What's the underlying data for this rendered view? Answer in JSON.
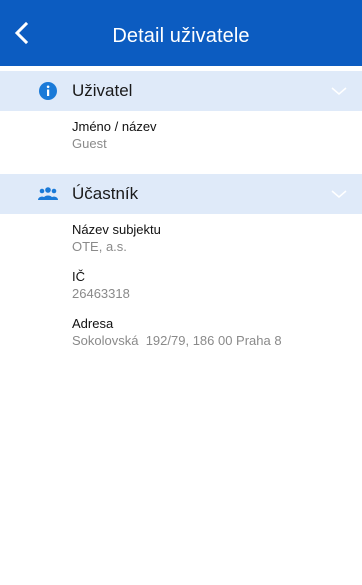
{
  "app_bar": {
    "title": "Detail uživatele",
    "back_icon": "chevron-left-icon"
  },
  "sections": [
    {
      "title": "Uživatel",
      "icon": "info-icon",
      "fields": [
        {
          "label": "Jméno / název",
          "value": "Guest"
        }
      ]
    },
    {
      "title": "Účastník",
      "icon": "people-icon",
      "fields": [
        {
          "label": "Název subjektu",
          "value": "OTE, a.s."
        },
        {
          "label": "IČ",
          "value": "26463318"
        },
        {
          "label": "Adresa",
          "value": "Sokolovská  192/79, 186 00 Praha 8"
        }
      ]
    }
  ],
  "colors": {
    "primary": "#0c5cc1",
    "section_bg": "#dfeaf9",
    "icon_blue": "#1a7ad8",
    "value_gray": "#8a8a8a"
  }
}
